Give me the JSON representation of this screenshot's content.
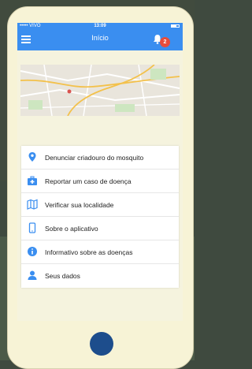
{
  "statusbar": {
    "carrier": "••••• VIVO",
    "time": "13:09"
  },
  "header": {
    "title": "Início",
    "notification_count": "2"
  },
  "menu": {
    "items": [
      {
        "label": "Denunciar criadouro do mosquito",
        "icon": "map-pin-icon"
      },
      {
        "label": "Reportar um caso de doença",
        "icon": "first-aid-kit-icon"
      },
      {
        "label": "Verificar sua localidade",
        "icon": "map-icon"
      },
      {
        "label": "Sobre o aplicativo",
        "icon": "smartphone-icon"
      },
      {
        "label": "Informativo sobre as doenças",
        "icon": "info-icon"
      },
      {
        "label": "Seus dados",
        "icon": "user-icon"
      }
    ]
  },
  "colors": {
    "accent": "#3a8ef0",
    "badge": "#e74c3c",
    "home_button": "#1d4d8c",
    "screen_bg": "#f5f3de"
  }
}
